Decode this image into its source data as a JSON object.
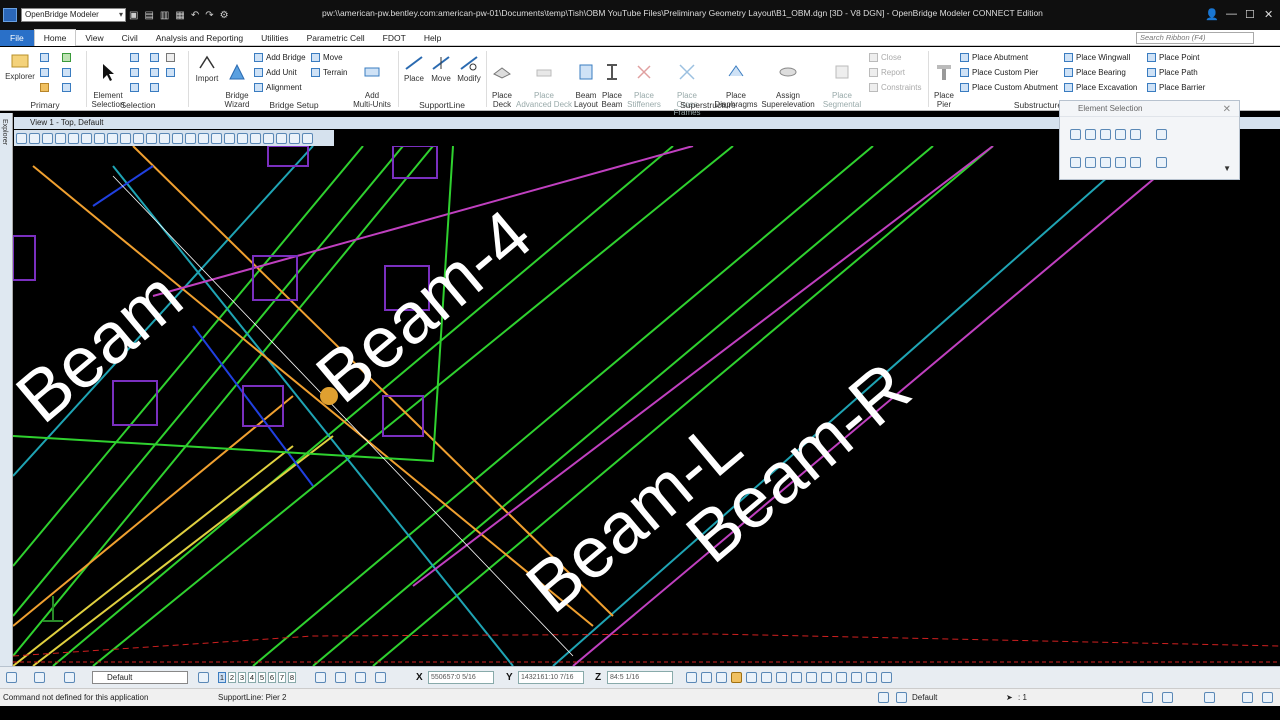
{
  "app": {
    "workspace": "OpenBridge Modeler",
    "window_title": "pw:\\\\american-pw.bentley.com:american-pw-01\\Documents\\temp\\Tish\\OBM YouTube Files\\Preliminary Geometry Layout\\B1_OBM.dgn [3D - V8 DGN] - OpenBridge Modeler CONNECT Edition"
  },
  "tabs": [
    "File",
    "Home",
    "View",
    "Civil",
    "Analysis and Reporting",
    "Utilities",
    "Parametric Cell",
    "FDOT",
    "Help"
  ],
  "active_tab": "Home",
  "search_placeholder": "Search Ribbon (F4)",
  "ribbon": {
    "primary": {
      "label": "Primary",
      "explorer": "Explorer"
    },
    "selection": {
      "label": "Selection",
      "element_selection": "Element\nSelection"
    },
    "bridge_setup": {
      "label": "Bridge Setup",
      "import": "Import",
      "bridge_wizard": "Bridge\nWizard",
      "place_bridge": "Add Bridge",
      "add_unit": "Add Unit",
      "alignment": "Alignment",
      "move": "Move",
      "terrain": "Terrain",
      "add_multi_units": "Add\nMulti-Units"
    },
    "supportline": {
      "label": "SupportLine",
      "place": "Place",
      "move": "Move",
      "modify": "Modify"
    },
    "superstructure": {
      "label": "Superstructure",
      "place_deck": "Place\nDeck",
      "place_advanced_deck": "Place\nAdvanced Deck",
      "beam_layout": "Beam\nLayout",
      "place_beam": "Place\nBeam",
      "place_stiffeners": "Place\nStiffeners",
      "place_cross_frames": "Place\nCross Frames",
      "place_diaphragms": "Place\nDiaphragms",
      "assign_superelevation": "Assign\nSuperelevation",
      "place_segmental": "Place\nSegmental",
      "close": "Close",
      "report": "Report",
      "constraints": "Constraints"
    },
    "substructure": {
      "label": "Substructure",
      "place_pier": "Place\nPier",
      "place_abutment": "Place Abutment",
      "place_custom_pier": "Place Custom Pier",
      "place_custom_abutment": "Place Custom Abutment",
      "place_wingwall": "Place Wingwall",
      "place_bearing": "Place Bearing",
      "place_excavation": "Place Excavation",
      "place_point": "Place Point",
      "place_path": "Place Path",
      "place_barrier": "Place Barrier"
    }
  },
  "view": {
    "title": "View 1 - Top, Default",
    "explorer_tab": "Explorer",
    "labels": [
      {
        "text": "Beam-4"
      },
      {
        "text": "Beam-R"
      },
      {
        "text": "Beam-L"
      },
      {
        "text": "Beam"
      }
    ]
  },
  "element_selection_dialog": {
    "title": "Element Selection"
  },
  "bottom": {
    "level": "Default",
    "views": [
      "1",
      "2",
      "3",
      "4",
      "5",
      "6",
      "7",
      "8"
    ],
    "x_label": "X",
    "x_value": "550657:0 5/16",
    "y_label": "Y",
    "y_value": "1432161:10 7/16",
    "z_label": "Z",
    "z_value": "84:5 1/16"
  },
  "status": {
    "message": "Command not defined for this application",
    "prompt": "SupportLine: Pier 2",
    "active_level": "Default",
    "scale": ": 1"
  },
  "colors": {
    "green": "#2fd12f",
    "teal": "#1fa4b4",
    "orange": "#f0a030",
    "magenta": "#c040c0",
    "purple": "#7a2fbf",
    "yellow": "#e0d040",
    "blue": "#2040e0",
    "red": "#d02020",
    "white": "#ffffff"
  }
}
